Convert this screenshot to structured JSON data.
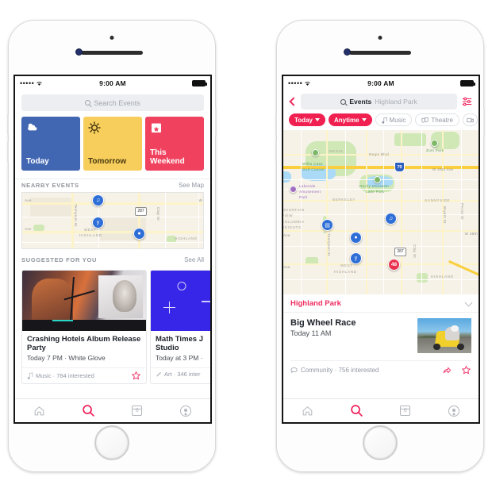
{
  "left_phone": {
    "status_bar": {
      "signal": "•••••",
      "wifi": "wifi-icon",
      "time": "9:00 AM",
      "battery": "battery-full-icon"
    },
    "search": {
      "placeholder": "Search Events",
      "icon": "search-icon"
    },
    "quick_tiles": [
      {
        "label": "Today",
        "icon": "cloud-sun-icon",
        "bg": "#4267B2",
        "fg": "#ffffff"
      },
      {
        "label": "Tomorrow",
        "icon": "sun-icon",
        "bg": "#F7CE5B",
        "fg": "#4a3a12"
      },
      {
        "label": "This Weekend",
        "icon": "calendar-star-icon",
        "bg": "#F0425E",
        "fg": "#ffffff"
      }
    ],
    "nearby": {
      "title": "NEARBY EVENTS",
      "link": "See Map",
      "map_labels": [
        "Ave",
        "Tennyson St",
        "Clay St",
        "WEST HIGHLAND",
        "HIGHLAND",
        "W"
      ],
      "route_shield": "287",
      "pins": [
        "music-pin",
        "drink-pin",
        "community-pin"
      ]
    },
    "suggested": {
      "title": "SUGGESTED FOR YOU",
      "link": "See All",
      "cards": [
        {
          "image": "band-on-stage-photo",
          "title": "Crashing Hotels Album Release Party",
          "subtitle": "Today 7 PM · White Glove",
          "category_icon": "music-note-icon",
          "meta": "Music · 784 interested",
          "action_icon": "star-outline-icon"
        },
        {
          "image": "math-symbols-blue-graphic",
          "title": "Math Times J Studio",
          "subtitle": "Today at 3 PM ·",
          "category_icon": "art-palette-icon",
          "meta": "Art · 346 inter",
          "action_icon": "star-outline-icon"
        }
      ]
    },
    "tabbar": [
      {
        "name": "home",
        "icon": "home-icon",
        "active": false
      },
      {
        "name": "search",
        "icon": "search-icon",
        "active": true
      },
      {
        "name": "events",
        "icon": "calendar-icon",
        "badge": "6",
        "active": false
      },
      {
        "name": "profile",
        "icon": "profile-icon",
        "active": false
      }
    ]
  },
  "right_phone": {
    "status_bar": {
      "signal": "•••••",
      "wifi": "wifi-icon",
      "time": "9:00 AM",
      "battery": "battery-full-icon"
    },
    "nav": {
      "back_icon": "back-chevron-icon",
      "search_icon": "search-icon",
      "query": "Events",
      "query_location": "Highland Park",
      "filter_icon": "sliders-icon"
    },
    "chips": [
      {
        "label": "Today",
        "style": "pink",
        "caret": true
      },
      {
        "label": "Anytime",
        "style": "pink",
        "caret": true
      },
      {
        "label": "Music",
        "style": "plain",
        "icon": "music-note-icon"
      },
      {
        "label": "Theatre",
        "style": "plain",
        "icon": "masks-icon"
      },
      {
        "label": "",
        "style": "plain",
        "icon": "film-icon"
      }
    ],
    "map": {
      "area_labels": [
        "REGIS",
        "BERKELEY",
        "SUNNYSIDE",
        "MOUNTAIN VIEW",
        "COLUMBIA HEIGHTS",
        "WEST HIGHLAND",
        "HIGHLAND"
      ],
      "place_labels": [
        "Willis Case Golf Course",
        "Zuni Park",
        "Lakeside Amusement Park",
        "Rocky Mountain Lake Park"
      ],
      "street_labels": [
        "Regis Blvd",
        "W 48th Ave",
        "Tennyson St",
        "Bryant St",
        "Pecos St",
        "Clay St",
        "W 38th",
        "Ave"
      ],
      "highway_shield": "70",
      "route_shield": "287",
      "pins": [
        "music-pin",
        "theatre-pin",
        "community-pin",
        "drink-pin"
      ],
      "selected_pin": "48"
    },
    "location_header": {
      "name": "Highland Park",
      "chevron": "chevron-down-icon"
    },
    "event": {
      "title": "Big Wheel Race",
      "subtitle": "Today 11 AM",
      "image": "big-wheel-race-photo",
      "category_icon": "community-icon",
      "meta": "Community · 756 interested",
      "share_icon": "share-icon",
      "star_icon": "star-outline-icon"
    },
    "tabbar": [
      {
        "name": "home",
        "icon": "home-icon",
        "active": false
      },
      {
        "name": "search",
        "icon": "search-icon",
        "active": true
      },
      {
        "name": "events",
        "icon": "calendar-icon",
        "badge": "6",
        "active": false
      },
      {
        "name": "profile",
        "icon": "profile-icon",
        "active": false
      }
    ]
  },
  "theme": {
    "accent_pink": "#F0215C",
    "blue": "#4267B2",
    "yellow": "#F7CE5B",
    "map_pin_blue": "#2E6ED6",
    "map_pin_red": "#E8304F"
  }
}
